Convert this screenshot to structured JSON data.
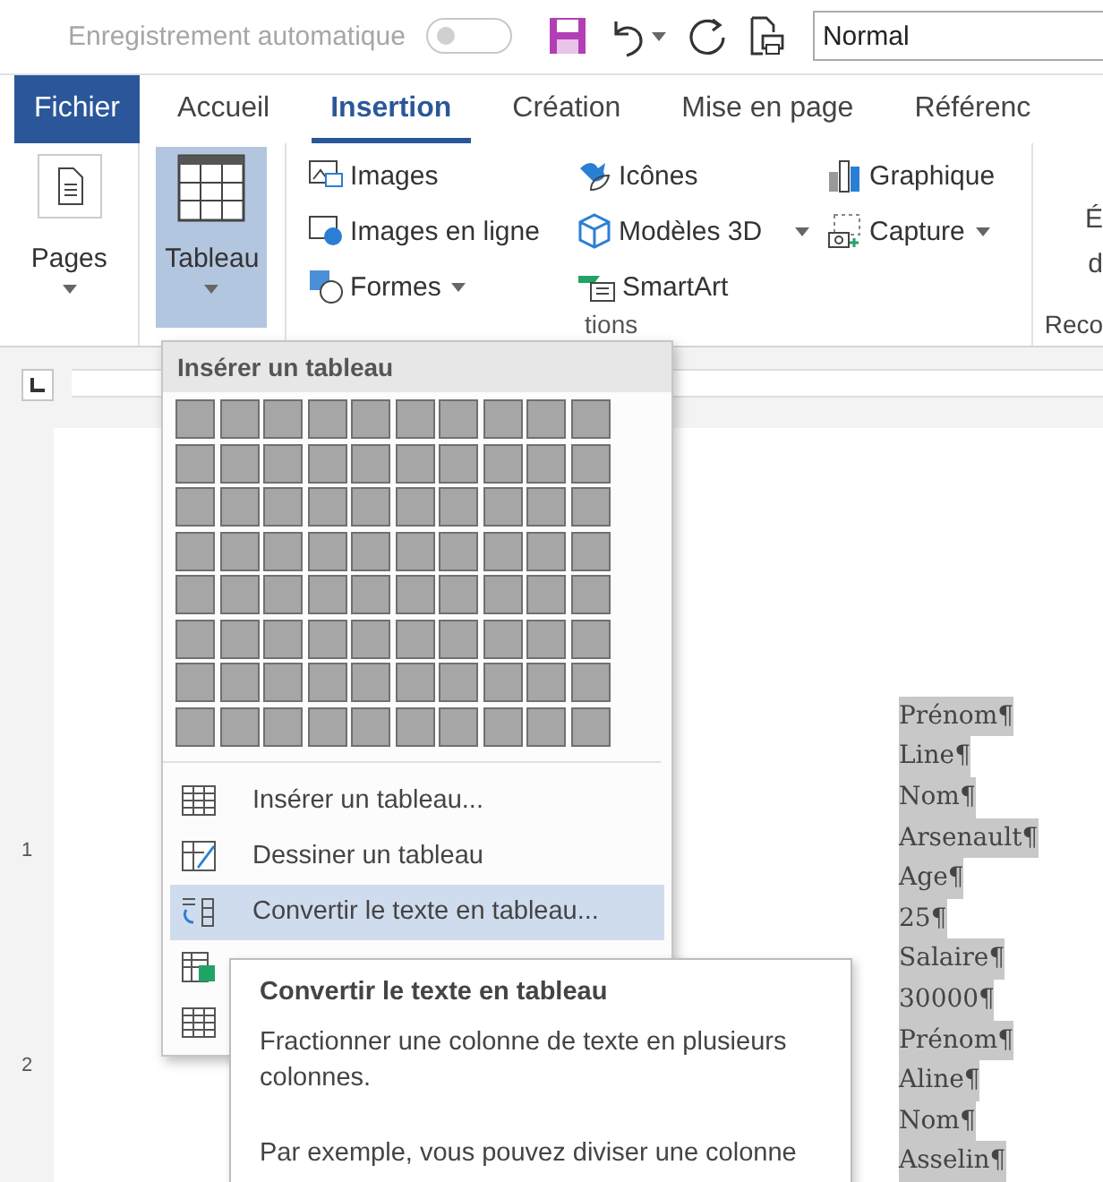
{
  "quick_access": {
    "autosave_label": "Enregistrement automatique",
    "autosave": {
      "on": false
    },
    "style_box": "Normal"
  },
  "tabs": [
    {
      "label": "Fichier",
      "kind": "file",
      "selected": false
    },
    {
      "label": "Accueil",
      "kind": "tab",
      "selected": false
    },
    {
      "label": "Insertion",
      "kind": "tab",
      "selected": true
    },
    {
      "label": "Création",
      "kind": "tab",
      "selected": false
    },
    {
      "label": "Mise en page",
      "kind": "tab",
      "selected": false
    },
    {
      "label": "Référenc",
      "kind": "tab",
      "selected": false
    }
  ],
  "ribbon": {
    "pages": {
      "label": "Pages"
    },
    "table": {
      "label": "Tableau",
      "selected": true
    },
    "illustrations": {
      "columns": [
        [
          {
            "label": "Images",
            "dropdown": false
          },
          {
            "label": "Images en ligne",
            "dropdown": false
          },
          {
            "label": "Formes",
            "dropdown": true
          }
        ],
        [
          {
            "label": "Icônes",
            "dropdown": false
          },
          {
            "label": "Modèles 3D",
            "dropdown": true
          },
          {
            "label": "SmartArt",
            "dropdown": false
          }
        ],
        [
          {
            "label": "Graphique",
            "dropdown": false
          },
          {
            "label": "Capture",
            "dropdown": true
          }
        ]
      ],
      "group_label": "tions"
    },
    "cut_group": {
      "lines": [
        "É",
        "d"
      ],
      "group_label": "Reco"
    }
  },
  "ruler": {
    "vertical_numbers": [
      "1",
      "2"
    ]
  },
  "document_lines": [
    "Prénom¶",
    "Line¶",
    "Nom¶",
    "Arsenault¶",
    "Age¶",
    "25¶",
    "Salaire¶",
    "30000¶",
    "Prénom¶",
    "Aline¶",
    "Nom¶",
    "Asselin¶"
  ],
  "table_menu": {
    "header": "Insérer un tableau",
    "items": [
      {
        "label": "Insérer un tableau...",
        "selected": false
      },
      {
        "label": "Dessiner un tableau",
        "selected": false
      },
      {
        "label": "Convertir le texte en tableau...",
        "selected": true
      },
      {
        "selected": false
      },
      {
        "selected": false
      }
    ]
  },
  "tooltip": {
    "title": "Convertir le texte en tableau",
    "paragraphs": [
      "Fractionner une colonne de texte en plusieurs colonnes.",
      "Par exemple, vous pouvez diviser une colonne"
    ]
  }
}
